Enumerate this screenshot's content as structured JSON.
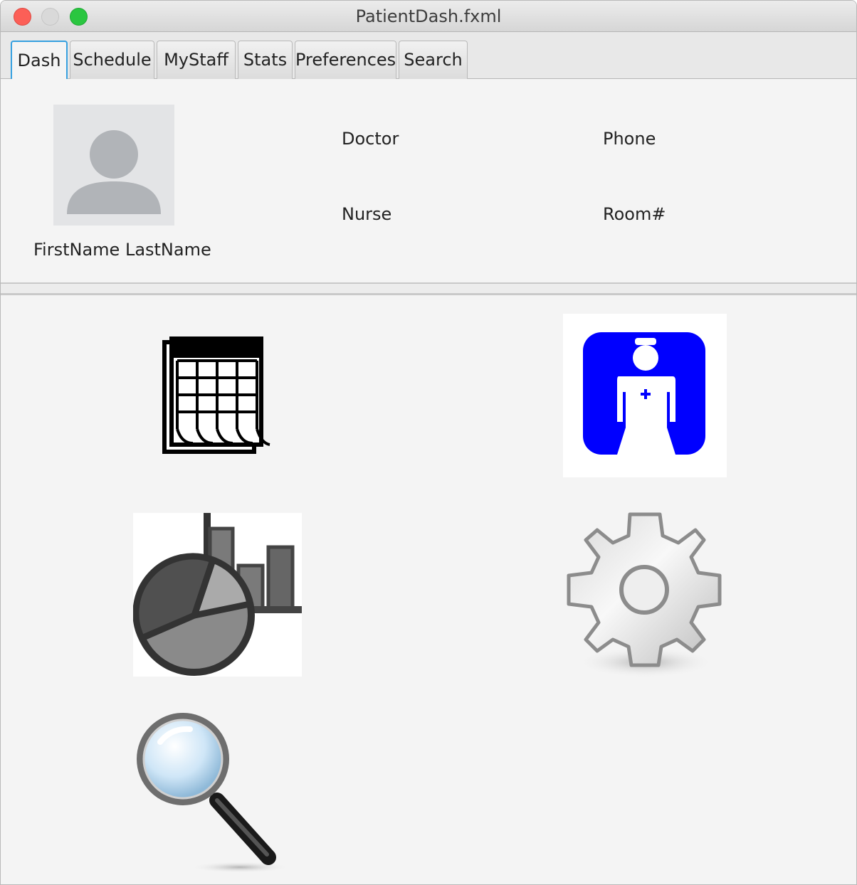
{
  "window": {
    "title": "PatientDash.fxml"
  },
  "tabs": [
    {
      "label": "Dash",
      "active": true
    },
    {
      "label": "Schedule",
      "active": false
    },
    {
      "label": "MyStaff",
      "active": false
    },
    {
      "label": "Stats",
      "active": false
    },
    {
      "label": "Preferences",
      "active": false
    },
    {
      "label": "Search",
      "active": false
    }
  ],
  "patient": {
    "name": "FirstName LastName",
    "avatar_icon": "user-avatar-icon"
  },
  "fields": {
    "doctor_label": "Doctor",
    "nurse_label": "Nurse",
    "phone_label": "Phone",
    "room_label": "Room#"
  },
  "tiles": {
    "schedule_icon": "calendar-icon",
    "staff_icon": "nurse-icon",
    "stats_icon": "chart-icon",
    "preferences_icon": "gear-icon",
    "search_icon": "magnifier-icon"
  },
  "colors": {
    "active_tab": "#36a0e0",
    "nurse_bg": "#0000ff"
  }
}
